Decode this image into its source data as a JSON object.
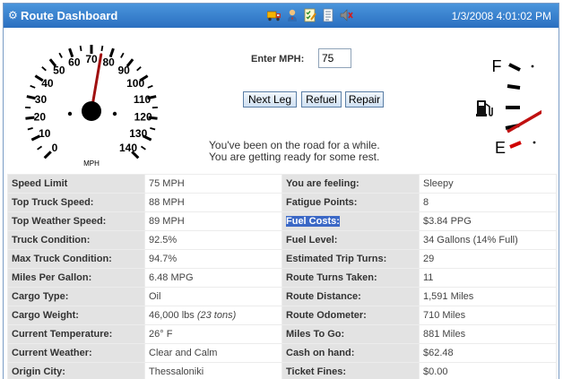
{
  "app": {
    "title": "Route Dashboard",
    "datetime": "1/3/2008 4:01:02 PM"
  },
  "toolbar": {
    "icons": [
      "truck-icon",
      "user-icon",
      "checklist-icon",
      "document-icon",
      "speaker-icon"
    ]
  },
  "speedometer": {
    "labels": [
      "0",
      "10",
      "20",
      "30",
      "40",
      "50",
      "60",
      "70",
      "80",
      "90",
      "100",
      "110",
      "120",
      "130",
      "140"
    ],
    "unit": "MPH",
    "needle_value": 75
  },
  "fuel_gauge": {
    "full_label": "F",
    "empty_label": "E",
    "level_fraction": 0.14,
    "pump_icon": "fuel-pump-icon"
  },
  "controls": {
    "mph_label": "Enter MPH:",
    "mph_value": "75",
    "next_leg": "Next Leg",
    "refuel": "Refuel",
    "repair": "Repair"
  },
  "status": {
    "line1": "You've been on the road for a while.",
    "line2": "You are getting ready for some rest."
  },
  "table": {
    "left": [
      {
        "label": "Speed Limit",
        "value": "75 MPH"
      },
      {
        "label": "Top Truck Speed:",
        "value": "88 MPH"
      },
      {
        "label": "Top Weather Speed:",
        "value": "89 MPH"
      },
      {
        "label": "Truck Condition:",
        "value": "92.5%"
      },
      {
        "label": "Max Truck Condition:",
        "value": "94.7%"
      },
      {
        "label": "Miles Per Gallon:",
        "value": "6.48 MPG"
      },
      {
        "label": "Cargo Type:",
        "value": "Oil"
      },
      {
        "label": "Cargo Weight:",
        "value": "46,000 lbs",
        "value_extra": "(23 tons)"
      },
      {
        "label": "Current Temperature:",
        "value": "26° F"
      },
      {
        "label": "Current Weather:",
        "value": "Clear and Calm"
      },
      {
        "label": "Origin City:",
        "value": "Thessaloniki"
      }
    ],
    "right": [
      {
        "label": "You are feeling:",
        "value": "Sleepy"
      },
      {
        "label": "Fatigue Points:",
        "value": "8"
      },
      {
        "label": "Fuel Costs:",
        "value": "$3.84 PPG"
      },
      {
        "label": "Fuel Level:",
        "value": "34 Gallons (14% Full)"
      },
      {
        "label": "Estimated Trip Turns:",
        "value": "29"
      },
      {
        "label": "Route Turns Taken:",
        "value": "11"
      },
      {
        "label": "Route Distance:",
        "value": "1,591 Miles"
      },
      {
        "label": "Route Odometer:",
        "value": "710 Miles"
      },
      {
        "label": "Miles To Go:",
        "value": "881 Miles"
      },
      {
        "label": "Cash on hand:",
        "value": "$62.48"
      },
      {
        "label": "Ticket Fines:",
        "value": "$0.00"
      }
    ]
  }
}
